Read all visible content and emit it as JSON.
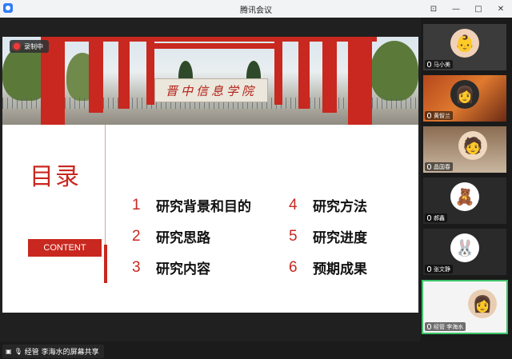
{
  "window": {
    "title": "腾讯会议"
  },
  "recording": {
    "label": "录制中"
  },
  "slide": {
    "title": "目录",
    "tag": "CONTENT",
    "banner_text": "晋中信息学院",
    "items": [
      {
        "num": "1",
        "text": "研究背景和目的"
      },
      {
        "num": "2",
        "text": "研究思路"
      },
      {
        "num": "3",
        "text": "研究内容"
      },
      {
        "num": "4",
        "text": "研究方法"
      },
      {
        "num": "5",
        "text": "研究进度"
      },
      {
        "num": "6",
        "text": "预期成果"
      }
    ]
  },
  "share_status": {
    "label": "经管 李海水的屏幕共享"
  },
  "participants": [
    {
      "name": "马小美"
    },
    {
      "name": "黄智兰"
    },
    {
      "name": "晶国春"
    },
    {
      "name": "郝鑫"
    },
    {
      "name": "张文静"
    },
    {
      "name": "经管 李海水"
    }
  ],
  "colors": {
    "accent": "#c8281f",
    "speaker": "#3dc26a"
  }
}
